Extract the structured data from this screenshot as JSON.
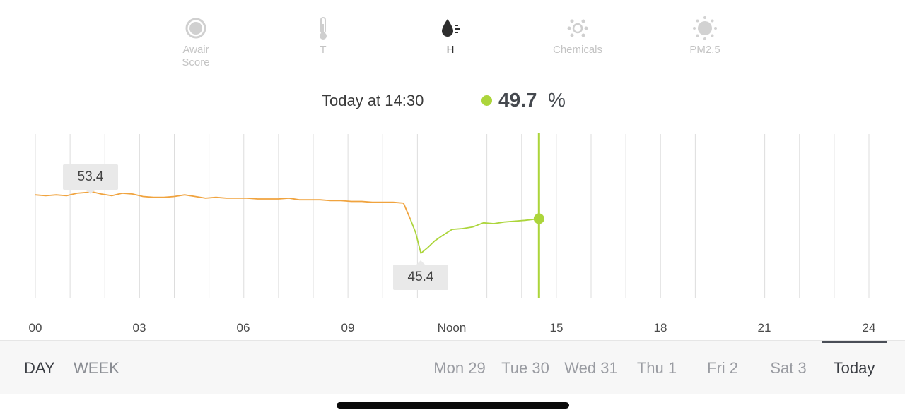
{
  "metrics": [
    {
      "id": "awair-score",
      "label": "Awair\nScore",
      "icon": "awair-score-icon",
      "active": false
    },
    {
      "id": "temperature",
      "label": "T",
      "icon": "thermometer-icon",
      "active": false
    },
    {
      "id": "humidity",
      "label": "H",
      "icon": "humidity-drop-icon",
      "active": true
    },
    {
      "id": "chemicals",
      "label": "Chemicals",
      "icon": "chemicals-icon",
      "active": false
    },
    {
      "id": "pm25",
      "label": "PM2.5",
      "icon": "pm25-icon",
      "active": false
    }
  ],
  "reading": {
    "time": "Today at 14:30",
    "value": "49.7",
    "unit": "%",
    "status_color": "#acd53b"
  },
  "chart_data": {
    "type": "line",
    "x_unit": "hour of day",
    "xlim": [
      0,
      24
    ],
    "ylim": [
      40,
      60
    ],
    "x_ticks": [
      "00",
      "03",
      "06",
      "09",
      "Noon",
      "15",
      "18",
      "21",
      "24"
    ],
    "cursor_x": 14.5,
    "max_annotation": {
      "x": 1.6,
      "value": "53.4"
    },
    "min_annotation": {
      "x": 11.1,
      "value": "45.4"
    },
    "colors": {
      "past": "#f0a33e",
      "recent": "#acd53b",
      "cursor": "#acd53b",
      "grid": "#dddddd"
    },
    "color_change_x": 10.8,
    "series": [
      {
        "x": [
          0,
          0.3,
          0.6,
          0.9,
          1.2,
          1.5,
          1.6,
          1.9,
          2.2,
          2.5,
          2.8,
          3.1,
          3.4,
          3.7,
          4.0,
          4.3,
          4.6,
          4.9,
          5.2,
          5.5,
          5.8,
          6.1,
          6.4,
          6.7,
          7.0,
          7.3,
          7.6,
          7.9,
          8.2,
          8.5,
          8.8,
          9.1,
          9.4,
          9.7,
          10.0,
          10.3,
          10.6,
          10.8,
          10.95,
          11.1,
          11.3,
          11.5,
          11.7,
          12.0,
          12.3,
          12.6,
          12.9,
          13.2,
          13.5,
          13.8,
          14.1,
          14.5
        ],
        "y": [
          52.6,
          52.5,
          52.6,
          52.5,
          52.8,
          52.9,
          53.0,
          52.7,
          52.5,
          52.8,
          52.7,
          52.4,
          52.3,
          52.3,
          52.4,
          52.6,
          52.4,
          52.2,
          52.3,
          52.2,
          52.2,
          52.2,
          52.1,
          52.1,
          52.1,
          52.2,
          52.0,
          52.0,
          52.0,
          51.9,
          51.9,
          51.8,
          51.8,
          51.7,
          51.7,
          51.7,
          51.6,
          49.6,
          48.0,
          45.5,
          46.2,
          47.0,
          47.6,
          48.4,
          48.5,
          48.7,
          49.2,
          49.1,
          49.3,
          49.4,
          49.5,
          49.7
        ]
      }
    ]
  },
  "bottom_bar": {
    "ranges": [
      {
        "label": "DAY",
        "active": true
      },
      {
        "label": "WEEK",
        "active": false
      }
    ],
    "days": [
      {
        "label": "Mon 29",
        "active": false
      },
      {
        "label": "Tue 30",
        "active": false
      },
      {
        "label": "Wed 31",
        "active": false
      },
      {
        "label": "Thu 1",
        "active": false
      },
      {
        "label": "Fri 2",
        "active": false
      },
      {
        "label": "Sat 3",
        "active": false
      },
      {
        "label": "Today",
        "active": true
      }
    ]
  }
}
